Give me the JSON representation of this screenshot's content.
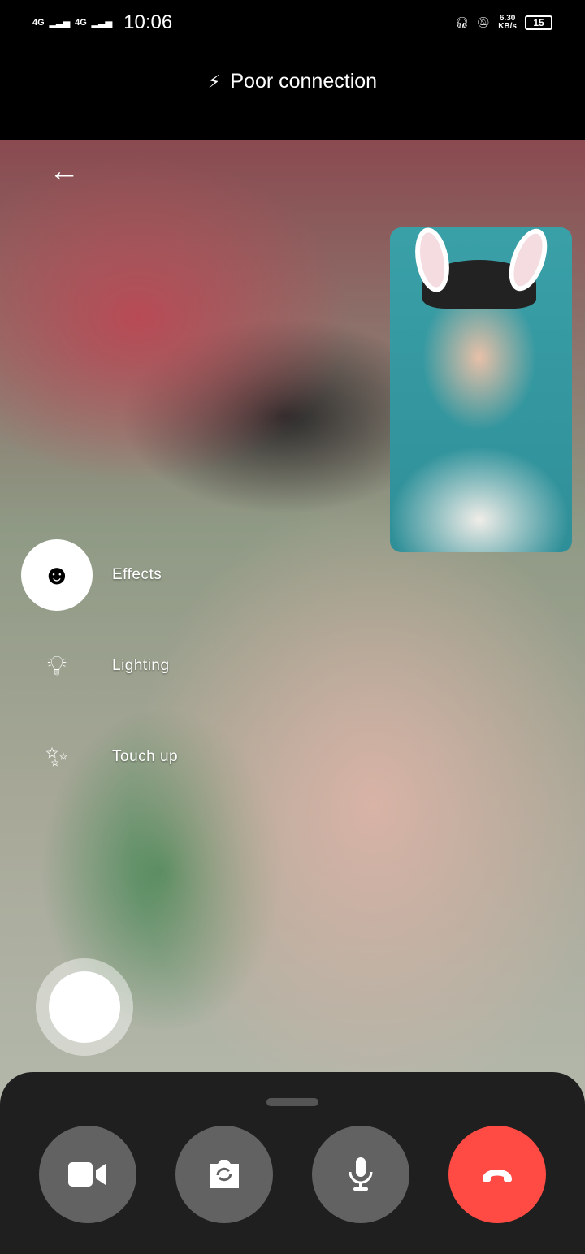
{
  "status_bar": {
    "signal1": "4G",
    "signal2": "4G",
    "time": "10:06",
    "net_speed": "6.30",
    "net_unit": "KB/s",
    "battery": "15"
  },
  "connection": {
    "text": "Poor connection"
  },
  "tools": [
    {
      "label": "Effects"
    },
    {
      "label": "Lighting"
    },
    {
      "label": "Touch up"
    }
  ],
  "colors": {
    "end_call": "#ff4b44",
    "control_bg": "#626262",
    "sheet_bg": "#1f1f1f"
  }
}
